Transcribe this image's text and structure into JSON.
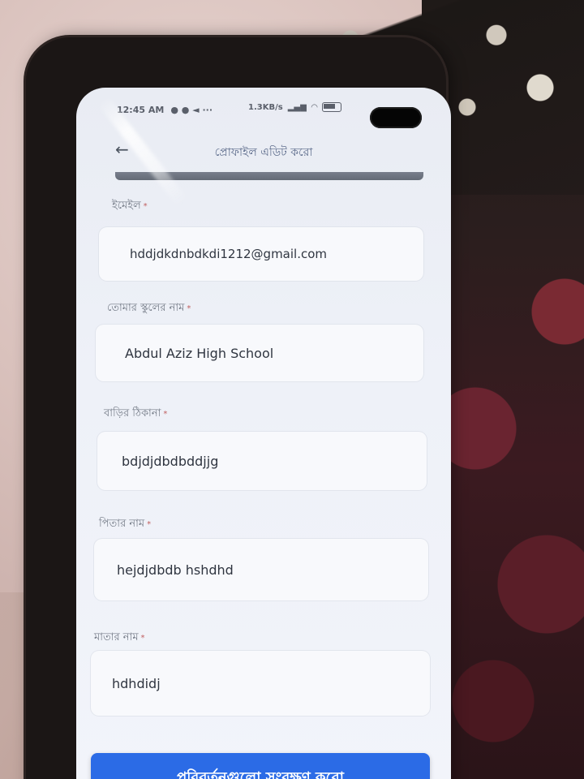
{
  "status_bar": {
    "time": "12:45 AM",
    "speed": "1.3KB/s"
  },
  "header": {
    "title": "প্রোফাইল এডিট করো",
    "back_icon": "arrow-left-icon"
  },
  "form": {
    "fields": [
      {
        "label": "ইমেইল",
        "required_mark": "*",
        "value": "hddjdkdnbdkdi1212@gmail.com"
      },
      {
        "label": "তোমার স্কুলের নাম",
        "required_mark": "*",
        "value": "Abdul Aziz High School"
      },
      {
        "label": "বাড়ির ঠিকানা",
        "required_mark": "*",
        "value": "bdjdjdbdbddjjg"
      },
      {
        "label": "পিতার নাম",
        "required_mark": "*",
        "value": "hejdjdbdb hshdhd"
      },
      {
        "label": "মাতার নাম",
        "required_mark": "*",
        "value": "hdhdidj"
      }
    ],
    "save_label": "পরিবর্তনগুলো সংরক্ষণ করো"
  },
  "colors": {
    "accent": "#2b6be6"
  }
}
